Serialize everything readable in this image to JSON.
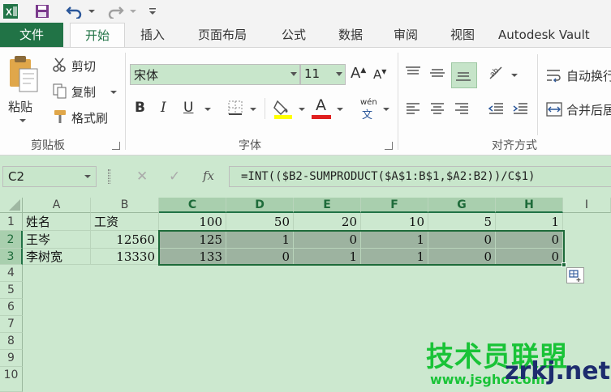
{
  "qat": {
    "app_icon": "excel-logo-icon",
    "save_icon": "save-icon",
    "undo_icon": "undo-icon",
    "redo_icon": "redo-icon",
    "customize_icon": "customize-toolbar-icon"
  },
  "tabs": [
    "文件",
    "开始",
    "插入",
    "页面布局",
    "公式",
    "数据",
    "审阅",
    "视图",
    "Autodesk Vault"
  ],
  "active_tab": "开始",
  "clipboard": {
    "paste": "粘贴",
    "cut": "剪切",
    "copy": "复制",
    "format_painter": "格式刷",
    "group_label": "剪贴板"
  },
  "font": {
    "family": "宋体",
    "size": "11",
    "grow": "A",
    "shrink": "A",
    "bold": "B",
    "italic": "I",
    "underline": "U",
    "phonetic_top": "wén",
    "phonetic_bottom": "文",
    "color_letter": "A",
    "group_label": "字体"
  },
  "alignment": {
    "wrap_text": "自动换行",
    "merge_center": "合并后居中",
    "group_label": "对齐方式"
  },
  "formula_bar": {
    "name_box": "C2",
    "fx": "fx",
    "formula": "=INT(($B2-SUMPRODUCT($A$1:B$1,$A2:B2))/C$1)"
  },
  "colors": {
    "accent": "#217346",
    "sheet_bg": "#cce8cf",
    "selection": "#9db3a0"
  },
  "columns": [
    "A",
    "B",
    "C",
    "D",
    "E",
    "F",
    "G",
    "H",
    "I"
  ],
  "rows": [
    "1",
    "2",
    "3",
    "4",
    "5",
    "6",
    "7",
    "8",
    "9",
    "10"
  ],
  "cells": {
    "r1": [
      "姓名",
      "工资",
      "100",
      "50",
      "20",
      "10",
      "5",
      "1"
    ],
    "r2": [
      "王岑",
      "12560",
      "125",
      "1",
      "0",
      "1",
      "0",
      "0"
    ],
    "r3": [
      "李树宽",
      "13330",
      "133",
      "0",
      "1",
      "1",
      "0",
      "0"
    ]
  },
  "watermark": {
    "cn": "技术员联盟",
    "url": "www.jsgho.com",
    "site": "zrkj.net"
  }
}
